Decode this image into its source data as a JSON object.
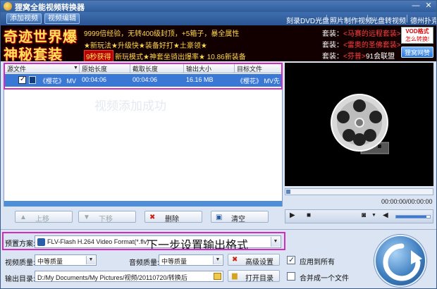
{
  "window": {
    "title": "狸窝全能视频转换器",
    "min_glyph": "—",
    "close_glyph": "✕"
  },
  "tabs": [
    {
      "label": "添加视频"
    },
    {
      "label": "视频编辑"
    }
  ],
  "top_links": [
    {
      "label": "刻录DVD光盘"
    },
    {
      "label": "照片制作视频"
    },
    {
      "label": "光盘转视频"
    },
    {
      "label": "德州扑克"
    }
  ],
  "banner": {
    "headline1": "奇迹世界爆",
    "headline2": "神秘套装",
    "line1": "9999倍经验，无转400级封顶，+5箱子，暴全属性",
    "line2": "★新玩法★升级快★装备好打★土豪领★",
    "line3_box": "9秒获得",
    "line3": "新玩模式★神套坐骑出爆率★ 10.86新装备",
    "right_rows": [
      {
        "prefix": "套装：",
        "item": "<马赛的远程套装>"
      },
      {
        "prefix": "套装：",
        "item": "<雷奥的圣佛套装>"
      },
      {
        "prefix": "套装：",
        "item": "<芬普>"
      }
    ],
    "bottom_right": "91会联盟",
    "vod_line1": "VOD格式",
    "vod_line2": "怎么转换!",
    "sponsor_label": "狸窝网赞"
  },
  "filelist": {
    "columns": [
      "源文件",
      "原始长度",
      "截取长度",
      "输出大小",
      "目标文件"
    ],
    "rows": [
      {
        "source": "《樱花》 MV...",
        "original_length": "00:04:06",
        "clip_length": "00:04:06",
        "output_size": "16.16 MB",
        "target": "《樱花》 MV先"
      }
    ],
    "watermark": "视频添加成功"
  },
  "list_buttons": [
    {
      "label": "上移",
      "icon": "▲"
    },
    {
      "label": "下移",
      "icon": "▼"
    },
    {
      "label": "删除",
      "icon": "✖"
    },
    {
      "label": "清空",
      "icon": "▣"
    }
  ],
  "player": {
    "timecode": "00:00:00/00:00:00",
    "volume_level": 0.9
  },
  "settings": {
    "preset_label": "预置方案:",
    "preset_value": "FLV-Flash H.264 Video Format(*.flv)",
    "preset_hint": "下一步设置输出格式",
    "video_quality_label": "视频质量:",
    "video_quality_value": "中等质量",
    "audio_quality_label": "音频质量:",
    "audio_quality_value": "中等质量",
    "advanced_label": "高级设置",
    "apply_all_label": "应用到所有",
    "apply_all_checked": true,
    "output_dir_label": "输出目录:",
    "output_dir_value": "D:/My Documents/My Pictures/视频/20110720/转换后",
    "open_dir_label": "打开目录",
    "merge_label": "合并成一个文件",
    "merge_checked": false
  },
  "colors": {
    "accent": "#3a78d6",
    "annotation": "#d12bbf",
    "banner_bg": "#120000"
  }
}
